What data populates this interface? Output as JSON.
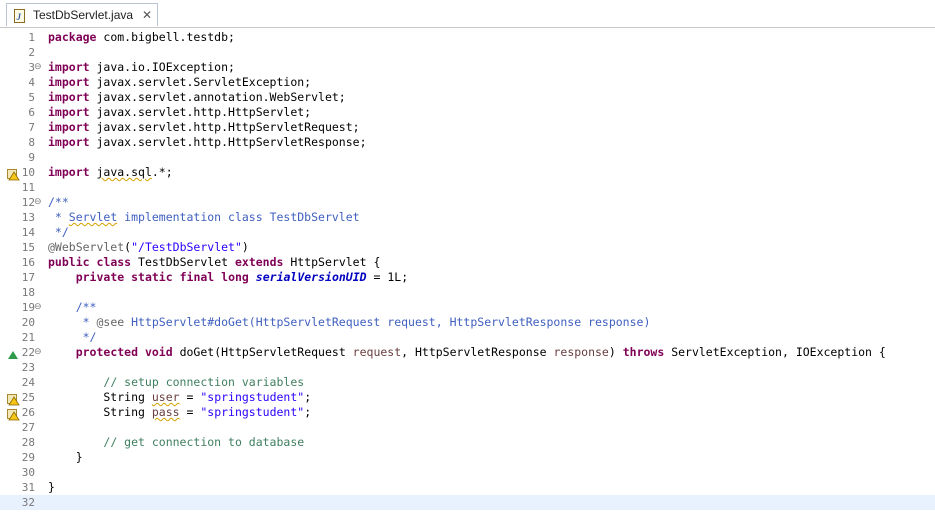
{
  "tab": {
    "title": "TestDbServlet.java",
    "close_label": "✕"
  },
  "editor": {
    "current_line": 32,
    "lines": [
      {
        "n": "1",
        "fold": "",
        "icon": "",
        "tokens": [
          {
            "t": "package",
            "c": "kw"
          },
          {
            "t": " com.bigbell.testdb;"
          }
        ]
      },
      {
        "n": "2",
        "fold": "",
        "icon": "",
        "tokens": []
      },
      {
        "n": "3",
        "fold": "⊖",
        "icon": "",
        "tokens": [
          {
            "t": "import",
            "c": "kw"
          },
          {
            "t": " java.io.IOException;"
          }
        ]
      },
      {
        "n": "4",
        "fold": "",
        "icon": "",
        "tokens": [
          {
            "t": "import",
            "c": "kw"
          },
          {
            "t": " javax.servlet.ServletException;"
          }
        ]
      },
      {
        "n": "5",
        "fold": "",
        "icon": "",
        "tokens": [
          {
            "t": "import",
            "c": "kw"
          },
          {
            "t": " javax.servlet.annotation.WebServlet;"
          }
        ]
      },
      {
        "n": "6",
        "fold": "",
        "icon": "",
        "tokens": [
          {
            "t": "import",
            "c": "kw"
          },
          {
            "t": " javax.servlet.http.HttpServlet;"
          }
        ]
      },
      {
        "n": "7",
        "fold": "",
        "icon": "",
        "tokens": [
          {
            "t": "import",
            "c": "kw"
          },
          {
            "t": " javax.servlet.http.HttpServletRequest;"
          }
        ]
      },
      {
        "n": "8",
        "fold": "",
        "icon": "",
        "tokens": [
          {
            "t": "import",
            "c": "kw"
          },
          {
            "t": " javax.servlet.http.HttpServletResponse;"
          }
        ]
      },
      {
        "n": "9",
        "fold": "",
        "icon": "",
        "tokens": []
      },
      {
        "n": "10",
        "fold": "",
        "icon": "warning-icon",
        "tokens": [
          {
            "t": "import",
            "c": "kw"
          },
          {
            "t": " "
          },
          {
            "t": "java.sql",
            "c": "sq"
          },
          {
            "t": ".*;"
          }
        ]
      },
      {
        "n": "11",
        "fold": "",
        "icon": "",
        "tokens": []
      },
      {
        "n": "12",
        "fold": "⊖",
        "icon": "",
        "tokens": [
          {
            "t": "/**",
            "c": "jd"
          }
        ]
      },
      {
        "n": "13",
        "fold": "",
        "icon": "",
        "tokens": [
          {
            "t": " * ",
            "c": "jd"
          },
          {
            "t": "Servlet",
            "c": "jd sq"
          },
          {
            "t": " implementation class TestDbServlet",
            "c": "jd"
          }
        ]
      },
      {
        "n": "14",
        "fold": "",
        "icon": "",
        "tokens": [
          {
            "t": " */",
            "c": "jd"
          }
        ]
      },
      {
        "n": "15",
        "fold": "",
        "icon": "",
        "tokens": [
          {
            "t": "@WebServlet",
            "c": "an"
          },
          {
            "t": "("
          },
          {
            "t": "\"/TestDbServlet\"",
            "c": "st"
          },
          {
            "t": ")"
          }
        ]
      },
      {
        "n": "16",
        "fold": "",
        "icon": "",
        "tokens": [
          {
            "t": "public",
            "c": "kw"
          },
          {
            "t": " "
          },
          {
            "t": "class",
            "c": "kw"
          },
          {
            "t": " TestDbServlet "
          },
          {
            "t": "extends",
            "c": "kw"
          },
          {
            "t": " HttpServlet {"
          }
        ]
      },
      {
        "n": "17",
        "fold": "",
        "icon": "",
        "tokens": [
          {
            "t": "    "
          },
          {
            "t": "private",
            "c": "kw"
          },
          {
            "t": " "
          },
          {
            "t": "static",
            "c": "kw"
          },
          {
            "t": " "
          },
          {
            "t": "final",
            "c": "kw"
          },
          {
            "t": " "
          },
          {
            "t": "long",
            "c": "kw"
          },
          {
            "t": " "
          },
          {
            "t": "serialVersionUID",
            "c": "fld"
          },
          {
            "t": " = 1L;"
          }
        ]
      },
      {
        "n": "18",
        "fold": "",
        "icon": "",
        "tokens": []
      },
      {
        "n": "19",
        "fold": "⊖",
        "icon": "",
        "tokens": [
          {
            "t": "    "
          },
          {
            "t": "/**",
            "c": "jd"
          }
        ]
      },
      {
        "n": "20",
        "fold": "",
        "icon": "",
        "tokens": [
          {
            "t": "     * ",
            "c": "jd"
          },
          {
            "t": "@see",
            "c": "an"
          },
          {
            "t": " HttpServlet#doGet(HttpServletRequest request, HttpServletResponse response)",
            "c": "jd"
          }
        ]
      },
      {
        "n": "21",
        "fold": "",
        "icon": "",
        "tokens": [
          {
            "t": "     */",
            "c": "jd"
          }
        ]
      },
      {
        "n": "22",
        "fold": "⊖",
        "icon": "override-icon",
        "tokens": [
          {
            "t": "    "
          },
          {
            "t": "protected",
            "c": "kw"
          },
          {
            "t": " "
          },
          {
            "t": "void",
            "c": "kw"
          },
          {
            "t": " doGet(HttpServletRequest "
          },
          {
            "t": "request",
            "c": "par"
          },
          {
            "t": ", HttpServletResponse "
          },
          {
            "t": "response",
            "c": "par"
          },
          {
            "t": ") "
          },
          {
            "t": "throws",
            "c": "kw"
          },
          {
            "t": " ServletException, IOException {"
          }
        ]
      },
      {
        "n": "23",
        "fold": "",
        "icon": "",
        "tokens": []
      },
      {
        "n": "24",
        "fold": "",
        "icon": "",
        "tokens": [
          {
            "t": "        "
          },
          {
            "t": "// setup connection variables",
            "c": "cm"
          }
        ]
      },
      {
        "n": "25",
        "fold": "",
        "icon": "warning-icon",
        "tokens": [
          {
            "t": "        String "
          },
          {
            "t": "user",
            "c": "par sq"
          },
          {
            "t": " = "
          },
          {
            "t": "\"springstudent\"",
            "c": "st"
          },
          {
            "t": ";"
          }
        ]
      },
      {
        "n": "26",
        "fold": "",
        "icon": "warning-icon",
        "tokens": [
          {
            "t": "        String "
          },
          {
            "t": "pass",
            "c": "par sq"
          },
          {
            "t": " = "
          },
          {
            "t": "\"springstudent\"",
            "c": "st"
          },
          {
            "t": ";"
          }
        ]
      },
      {
        "n": "27",
        "fold": "",
        "icon": "",
        "tokens": []
      },
      {
        "n": "28",
        "fold": "",
        "icon": "",
        "tokens": [
          {
            "t": "        "
          },
          {
            "t": "// get connection to database",
            "c": "cm"
          }
        ]
      },
      {
        "n": "29",
        "fold": "",
        "icon": "",
        "tokens": [
          {
            "t": "    }"
          }
        ]
      },
      {
        "n": "30",
        "fold": "",
        "icon": "",
        "tokens": []
      },
      {
        "n": "31",
        "fold": "",
        "icon": "",
        "tokens": [
          {
            "t": "}"
          }
        ]
      },
      {
        "n": "32",
        "fold": "",
        "icon": "",
        "tokens": []
      }
    ]
  }
}
